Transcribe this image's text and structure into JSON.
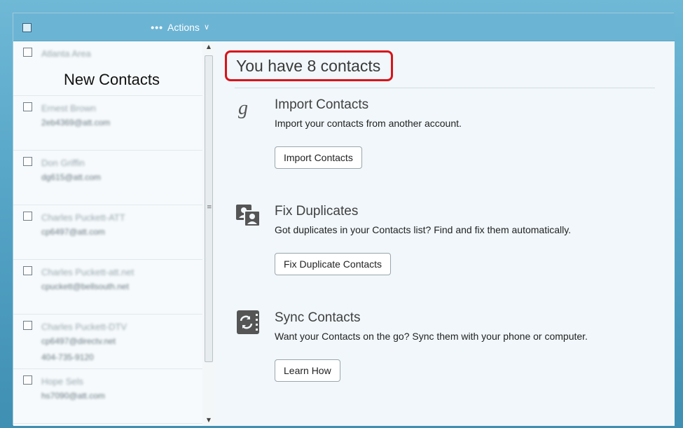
{
  "toolbar": {
    "actions_label": "Actions"
  },
  "contacts": {
    "overlay_title": "New Contacts",
    "items": [
      {
        "name": "Atlanta Area",
        "line2": "",
        "line3": ""
      },
      {
        "name": "Ernest Brown",
        "line2": "2eb4369@att.com",
        "line3": ""
      },
      {
        "name": "Don Griffin",
        "line2": "dg615@att.com",
        "line3": ""
      },
      {
        "name": "Charles Puckett-ATT",
        "line2": "cp6497@att.com",
        "line3": ""
      },
      {
        "name": "Charles Puckett-att.net",
        "line2": "cpuckett@bellsouth.net",
        "line3": ""
      },
      {
        "name": "Charles Puckett-DTV",
        "line2": "cp6497@directv.net",
        "line3": "404-735-9120"
      },
      {
        "name": "Hope Sels",
        "line2": "hs7090@att.com",
        "line3": ""
      }
    ]
  },
  "main": {
    "title": "You have 8 contacts",
    "sections": [
      {
        "icon": "google-g-icon",
        "title": "Import Contacts",
        "description": "Import your contacts from another account.",
        "button": "Import Contacts"
      },
      {
        "icon": "duplicate-contacts-icon",
        "title": "Fix Duplicates",
        "description": "Got duplicates in your Contacts list? Find and fix them automatically.",
        "button": "Fix Duplicate Contacts"
      },
      {
        "icon": "sync-icon",
        "title": "Sync Contacts",
        "description": "Want your Contacts on the go? Sync them with your phone or computer.",
        "button": "Learn How"
      }
    ]
  },
  "colors": {
    "header": "#6cb4d4",
    "highlight_border": "#d9131a"
  }
}
